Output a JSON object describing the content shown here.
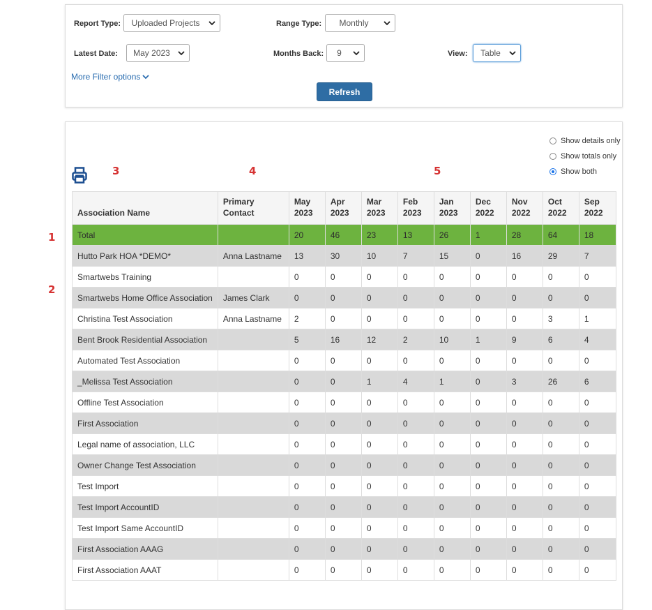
{
  "filters": {
    "report_type_label": "Report Type:",
    "report_type_value": "Uploaded Projects",
    "range_type_label": "Range Type:",
    "range_type_value": "Monthly",
    "latest_date_label": "Latest Date:",
    "latest_date_value": "May 2023",
    "months_back_label": "Months Back:",
    "months_back_value": "9",
    "view_label": "View:",
    "view_value": "Table",
    "more_filter_options": "More Filter options",
    "refresh_label": "Refresh"
  },
  "display_options": [
    {
      "label": "Show details only",
      "checked": false
    },
    {
      "label": "Show totals only",
      "checked": false
    },
    {
      "label": "Show both",
      "checked": true
    }
  ],
  "markers": [
    "1",
    "2",
    "3",
    "4",
    "5"
  ],
  "table": {
    "headers": [
      "Association Name",
      "Primary Contact",
      "May 2023",
      "Apr 2023",
      "Mar 2023",
      "Feb 2023",
      "Jan 2023",
      "Dec 2022",
      "Nov 2022",
      "Oct 2022",
      "Sep 2022"
    ],
    "total_row": {
      "name": "Total",
      "contact": "",
      "values": [
        "20",
        "46",
        "23",
        "13",
        "26",
        "1",
        "28",
        "64",
        "18"
      ]
    },
    "rows": [
      {
        "name": "Hutto Park HOA *DEMO*",
        "contact": "Anna Lastname",
        "values": [
          "13",
          "30",
          "10",
          "7",
          "15",
          "0",
          "16",
          "29",
          "7"
        ]
      },
      {
        "name": "Smartwebs Training",
        "contact": "",
        "values": [
          "0",
          "0",
          "0",
          "0",
          "0",
          "0",
          "0",
          "0",
          "0"
        ]
      },
      {
        "name": "Smartwebs Home Office Association",
        "contact": "James Clark",
        "values": [
          "0",
          "0",
          "0",
          "0",
          "0",
          "0",
          "0",
          "0",
          "0"
        ]
      },
      {
        "name": "Christina Test Association",
        "contact": "Anna Lastname",
        "values": [
          "2",
          "0",
          "0",
          "0",
          "0",
          "0",
          "0",
          "3",
          "1"
        ]
      },
      {
        "name": "Bent Brook Residential Association",
        "contact": "",
        "values": [
          "5",
          "16",
          "12",
          "2",
          "10",
          "1",
          "9",
          "6",
          "4"
        ]
      },
      {
        "name": "Automated Test Association",
        "contact": "",
        "values": [
          "0",
          "0",
          "0",
          "0",
          "0",
          "0",
          "0",
          "0",
          "0"
        ]
      },
      {
        "name": "_Melissa Test Association",
        "contact": "",
        "values": [
          "0",
          "0",
          "1",
          "4",
          "1",
          "0",
          "3",
          "26",
          "6"
        ]
      },
      {
        "name": "Offline Test Association",
        "contact": "",
        "values": [
          "0",
          "0",
          "0",
          "0",
          "0",
          "0",
          "0",
          "0",
          "0"
        ]
      },
      {
        "name": "First Association",
        "contact": "",
        "values": [
          "0",
          "0",
          "0",
          "0",
          "0",
          "0",
          "0",
          "0",
          "0"
        ]
      },
      {
        "name": "Legal name of association, LLC",
        "contact": "",
        "values": [
          "0",
          "0",
          "0",
          "0",
          "0",
          "0",
          "0",
          "0",
          "0"
        ]
      },
      {
        "name": "Owner Change Test Association",
        "contact": "",
        "values": [
          "0",
          "0",
          "0",
          "0",
          "0",
          "0",
          "0",
          "0",
          "0"
        ]
      },
      {
        "name": "Test Import",
        "contact": "",
        "values": [
          "0",
          "0",
          "0",
          "0",
          "0",
          "0",
          "0",
          "0",
          "0"
        ]
      },
      {
        "name": "Test Import AccountID",
        "contact": "",
        "values": [
          "0",
          "0",
          "0",
          "0",
          "0",
          "0",
          "0",
          "0",
          "0"
        ]
      },
      {
        "name": "Test Import Same AccountID",
        "contact": "",
        "values": [
          "0",
          "0",
          "0",
          "0",
          "0",
          "0",
          "0",
          "0",
          "0"
        ]
      },
      {
        "name": "First Association AAAG",
        "contact": "",
        "values": [
          "0",
          "0",
          "0",
          "0",
          "0",
          "0",
          "0",
          "0",
          "0"
        ]
      },
      {
        "name": "First Association AAAT",
        "contact": "",
        "values": [
          "0",
          "0",
          "0",
          "0",
          "0",
          "0",
          "0",
          "0",
          "0"
        ]
      }
    ]
  },
  "colors": {
    "total_row": "#6db33f",
    "shaded_row": "#d9d9d9",
    "accent": "#2e6da4",
    "marker": "#d63333"
  },
  "icons": {
    "print": "print-icon",
    "dropdown": "chevron-down-icon"
  }
}
